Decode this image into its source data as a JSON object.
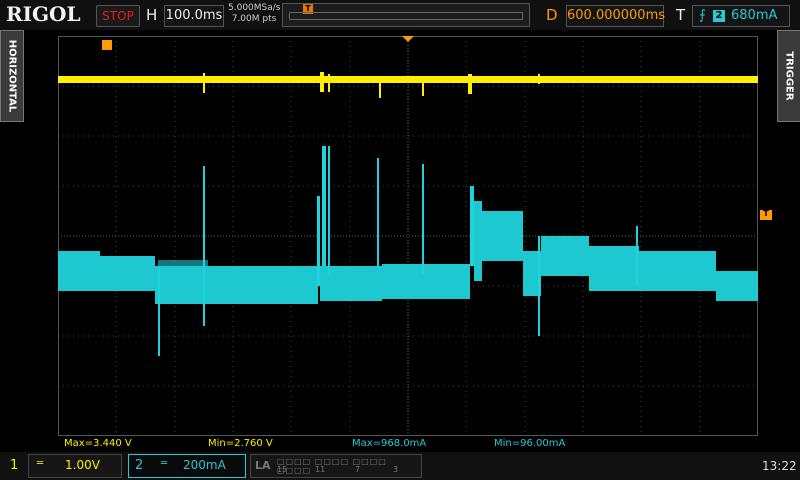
{
  "header": {
    "brand": "RIGOL",
    "run_state": "STOP",
    "timebase_label": "H",
    "timebase_value": "100.0ms",
    "sample_rate": "5.000MSa/s",
    "memory_depth": "7.00M pts",
    "delay_label": "D",
    "delay_value": "600.000000ms",
    "trigger_label": "T",
    "trigger_source": "2",
    "trigger_level": "680mA"
  },
  "side_tabs": {
    "left": "HORIZONTAL",
    "right": "TRIGGER"
  },
  "markers": {
    "ch1": "1",
    "ch2": "2",
    "trigger": "T"
  },
  "measurements": [
    {
      "text": "Max=3.440 V",
      "color": "#ffef00"
    },
    {
      "text": "Min=2.760 V",
      "color": "#ffef00"
    },
    {
      "text": "Max=968.0mA",
      "color": "#27c9d6"
    },
    {
      "text": "Min=96.00mA",
      "color": "#27c9d6"
    }
  ],
  "channels": {
    "ch1": {
      "number": "1",
      "scale": "1.00V",
      "color": "#ffef00"
    },
    "ch2": {
      "number": "2",
      "scale": "200mA",
      "color": "#27c9d6"
    }
  },
  "la": {
    "label": "LA",
    "digits": [
      "15",
      "11",
      "7",
      "3"
    ]
  },
  "clock": "13:22",
  "colors": {
    "ch1": "#ffef00",
    "ch2": "#27c9d6",
    "accent": "#ff9a00",
    "stop": "#e01e1e"
  }
}
